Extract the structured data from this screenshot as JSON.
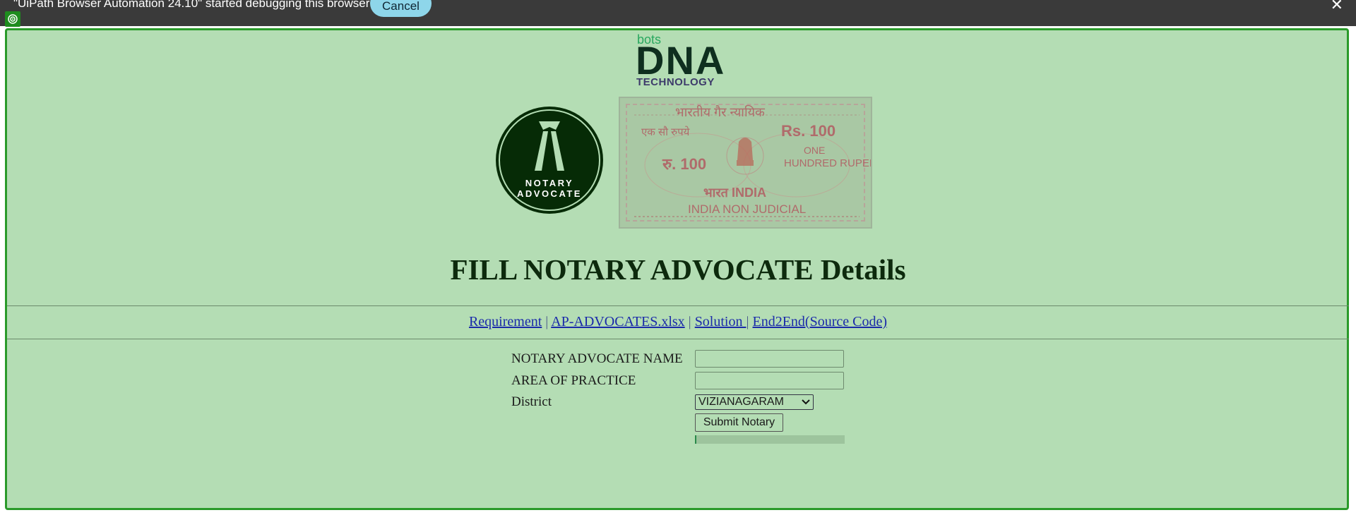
{
  "debug_bar": {
    "message": "\"UiPath Browser Automation 24.10\" started debugging this browser",
    "cancel_label": "Cancel",
    "close_glyph": "✕"
  },
  "logo": {
    "bots": "bots",
    "dna": "DNA",
    "technology": "TECHNOLOGY"
  },
  "badge": {
    "line1": "NOTARY",
    "line2": "ADVOCATE"
  },
  "stamp": {
    "hindi_top": "भारतीय गैर न्यायिक",
    "hindi_left": "एक सौ रुपये",
    "rs_right": "Rs. 100",
    "rs_left": "रु. 100",
    "one": "ONE",
    "hundred_rupees": "HUNDRED RUPEES",
    "bharat_india": "भारत INDIA",
    "india_non_judicial": "INDIA NON JUDICIAL"
  },
  "heading": "FILL NOTARY ADVOCATE Details",
  "links": {
    "requirement": "Requirement",
    "advocates_file": "AP-ADVOCATES.xlsx",
    "solution": "Solution ",
    "end2end": "End2End(Source Code)",
    "separator": "|"
  },
  "form": {
    "name_label": "NOTARY ADVOCATE NAME",
    "name_value": "",
    "area_label": "AREA OF PRACTICE",
    "area_value": "",
    "district_label": "District",
    "district_value": "VIZIANAGARAM",
    "submit_label": "Submit Notary",
    "progress": 0.01
  },
  "colors": {
    "page_bg": "#b4ddb4",
    "frame_border": "#2a9a2a",
    "badge_bg": "#062b06",
    "debug_bar_bg": "#3a3a3a",
    "cancel_bg": "#8ed6ea"
  }
}
